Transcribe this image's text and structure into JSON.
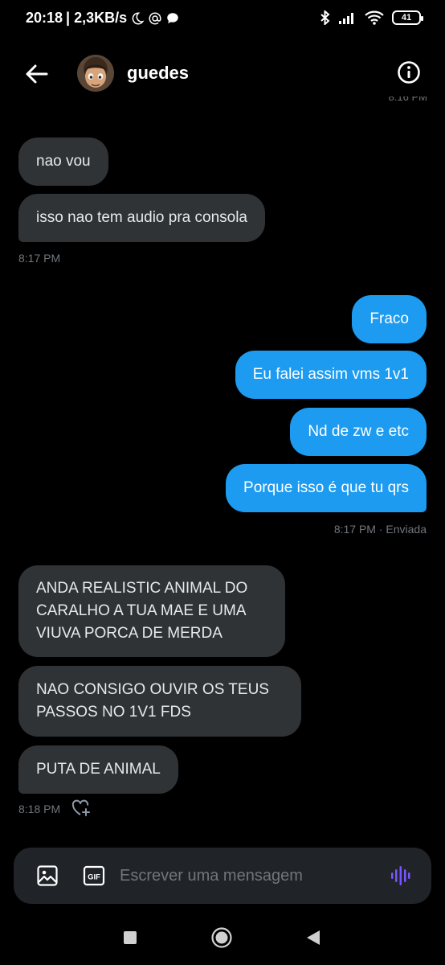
{
  "status_bar": {
    "time": "20:18",
    "net_speed": "| 2,3KB/s",
    "battery": "41"
  },
  "header": {
    "contact_name": "guedes"
  },
  "clipped_timestamp": "8:16 PM",
  "messages": [
    {
      "text": "nao vou"
    },
    {
      "text": "isso nao tem audio pra consola"
    },
    {
      "text": "Fraco"
    },
    {
      "text": "Eu falei assim vms 1v1"
    },
    {
      "text": "Nd de zw e etc"
    },
    {
      "text": "Porque isso é que tu qrs"
    },
    {
      "text": "ANDA REALISTIC ANIMAL DO CARALHO A TUA MAE E UMA VIUVA PORCA DE MERDA"
    },
    {
      "text": "NAO CONSIGO OUVIR OS TEUS PASSOS NO 1V1 FDS"
    },
    {
      "text": "PUTA DE ANIMAL"
    }
  ],
  "meta": {
    "recv_time_1": "8:17 PM",
    "sent_time": "8:17 PM · Enviada",
    "recv_time_2": "8:18 PM"
  },
  "composer": {
    "placeholder": "Escrever uma mensagem"
  },
  "colors": {
    "background": "#000000",
    "received_bubble": "#2f3336",
    "sent_bubble": "#1d9bf0",
    "composer": "#202327",
    "voice_accent": "#7856ff"
  }
}
